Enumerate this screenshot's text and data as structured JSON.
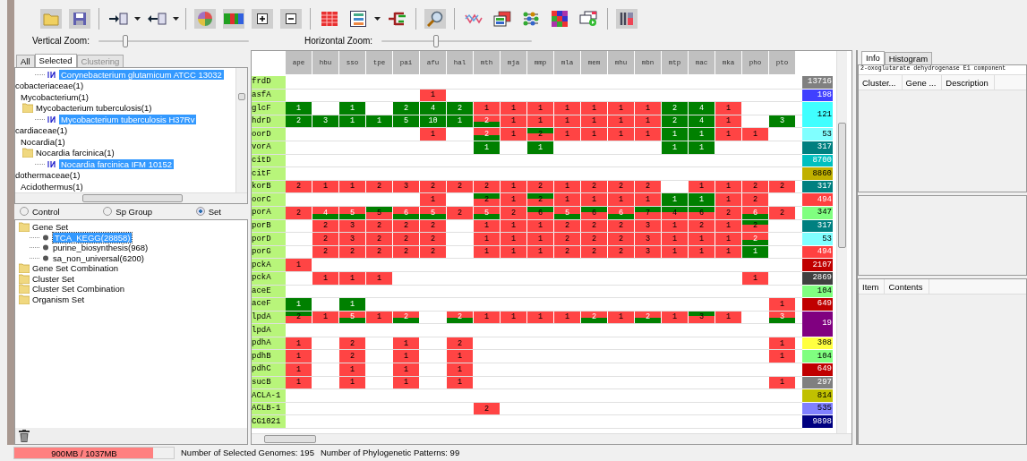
{
  "toolbar": {
    "vertical_zoom": {
      "label": "Vertical Zoom:",
      "level": 0.18
    },
    "horizontal_zoom": {
      "label": "Horizontal Zoom:",
      "level": 0.36
    }
  },
  "organism_panel": {
    "tabs": [
      {
        "label": "All",
        "selected": false,
        "disabled": false
      },
      {
        "label": "Selected",
        "selected": true,
        "disabled": false
      },
      {
        "label": "Clustering",
        "selected": false,
        "disabled": true
      }
    ],
    "tree": [
      {
        "label": "Corynebacterium glutamicum ATCC 13032",
        "kind": "strain",
        "selected": true
      },
      {
        "label": "cobacteriaceae(1)",
        "kind": "family",
        "selected": false,
        "children": [
          {
            "label": "Mycobacterium(1)",
            "kind": "genus",
            "selected": false,
            "children": [
              {
                "label": "Mycobacterium tuberculosis(1)",
                "kind": "species",
                "selected": false,
                "children": [
                  {
                    "label": "Mycobacterium tuberculosis H37Rv",
                    "kind": "strain",
                    "selected": true
                  }
                ]
              }
            ]
          }
        ]
      },
      {
        "label": "cardiaceae(1)",
        "kind": "family",
        "selected": false,
        "children": [
          {
            "label": "Nocardia(1)",
            "kind": "genus",
            "selected": false,
            "children": [
              {
                "label": "Nocardia farcinica(1)",
                "kind": "species",
                "selected": false,
                "children": [
                  {
                    "label": "Nocardia farcinica IFM 10152",
                    "kind": "strain",
                    "selected": true
                  }
                ]
              }
            ]
          }
        ]
      },
      {
        "label": "dothermaceae(1)",
        "kind": "family",
        "selected": false,
        "children": [
          {
            "label": "Acidothermus(1)",
            "kind": "genus",
            "selected": false
          }
        ]
      }
    ]
  },
  "set_panel": {
    "options": [
      {
        "label": "Control",
        "selected": false
      },
      {
        "label": "Sp Group",
        "selected": false
      },
      {
        "label": "Set",
        "selected": true
      }
    ],
    "tree": [
      {
        "label": "Gene Set",
        "kind": "folder",
        "selected": false,
        "children": [
          {
            "label": "TCA_KEGG(28858)",
            "kind": "set",
            "selected": true
          },
          {
            "label": "purine_biosynthesis(968)",
            "kind": "set",
            "selected": false
          },
          {
            "label": "sa_non_universal(6200)",
            "kind": "set",
            "selected": false
          }
        ]
      },
      {
        "label": "Gene Set Combination",
        "kind": "folder",
        "selected": false
      },
      {
        "label": "Cluster Set",
        "kind": "folder",
        "selected": false
      },
      {
        "label": "Cluster Set Combination",
        "kind": "folder",
        "selected": false
      },
      {
        "label": "Organism Set",
        "kind": "folder",
        "selected": false
      }
    ]
  },
  "grid": {
    "columns": [
      "ape",
      "hbu",
      "sso",
      "tpe",
      "pai",
      "afu",
      "hal",
      "mth",
      "mja",
      "mmp",
      "mla",
      "mem",
      "mhu",
      "mbn",
      "mtp",
      "mac",
      "mka",
      "pho",
      "pto"
    ],
    "rows": [
      {
        "gene": "frdD",
        "count": "13716",
        "color": "#808080",
        "merged_with_next": false,
        "cells": [
          null,
          null,
          null,
          null,
          null,
          null,
          null,
          null,
          null,
          null,
          null,
          null,
          null,
          null,
          null,
          null,
          null,
          null,
          null
        ]
      },
      {
        "gene": "asfA",
        "count": "198",
        "color": "#4040ff",
        "merged_with_next": false,
        "cells": [
          null,
          null,
          null,
          null,
          null,
          {
            "text": "1",
            "kind": "red"
          },
          null,
          null,
          null,
          null,
          null,
          null,
          null,
          null,
          null,
          null,
          null,
          null,
          null
        ]
      },
      {
        "gene": "glcF",
        "count": "121",
        "color": "#40ffff",
        "merged_with_next": true,
        "cells": [
          {
            "text": "1",
            "kind": "green"
          },
          null,
          {
            "text": "1",
            "kind": "green"
          },
          null,
          {
            "text": "2",
            "kind": "green"
          },
          {
            "text": "4",
            "kind": "green"
          },
          {
            "text": "2",
            "kind": "green"
          },
          {
            "text": "1",
            "kind": "red"
          },
          {
            "text": "1",
            "kind": "red"
          },
          {
            "text": "1",
            "kind": "red"
          },
          {
            "text": "1",
            "kind": "red"
          },
          {
            "text": "1",
            "kind": "red"
          },
          {
            "text": "1",
            "kind": "red"
          },
          {
            "text": "1",
            "kind": "red"
          },
          {
            "text": "2",
            "kind": "green"
          },
          {
            "text": "4",
            "kind": "green"
          },
          {
            "text": "1",
            "kind": "red"
          },
          null,
          null
        ]
      },
      {
        "gene": "hdrD",
        "cells": [
          {
            "text": "2",
            "kind": "green"
          },
          {
            "text": "3",
            "kind": "green"
          },
          {
            "text": "1",
            "kind": "green"
          },
          {
            "text": "1",
            "kind": "green"
          },
          {
            "text": "5",
            "kind": "green"
          },
          {
            "text": "10",
            "kind": "green"
          },
          {
            "text": "1",
            "kind": "green"
          },
          {
            "text": "2",
            "kind": "red-green"
          },
          {
            "text": "1",
            "kind": "red"
          },
          {
            "text": "1",
            "kind": "red"
          },
          {
            "text": "1",
            "kind": "red"
          },
          {
            "text": "1",
            "kind": "red"
          },
          {
            "text": "1",
            "kind": "red"
          },
          {
            "text": "1",
            "kind": "red"
          },
          {
            "text": "2",
            "kind": "green"
          },
          {
            "text": "4",
            "kind": "green"
          },
          {
            "text": "1",
            "kind": "red"
          },
          null,
          {
            "text": "3",
            "kind": "green"
          }
        ]
      },
      {
        "gene": "oorD",
        "count": "53",
        "color": "#80ffff",
        "merged_with_next": false,
        "cells": [
          null,
          null,
          null,
          null,
          null,
          {
            "text": "1",
            "kind": "red"
          },
          null,
          {
            "text": "2",
            "kind": "red-green"
          },
          {
            "text": "1",
            "kind": "red"
          },
          {
            "text": "2",
            "kind": "green-red"
          },
          {
            "text": "1",
            "kind": "red"
          },
          {
            "text": "1",
            "kind": "red"
          },
          {
            "text": "1",
            "kind": "red"
          },
          {
            "text": "1",
            "kind": "red"
          },
          {
            "text": "1",
            "kind": "green"
          },
          {
            "text": "1",
            "kind": "green"
          },
          {
            "text": "1",
            "kind": "red"
          },
          {
            "text": "1",
            "kind": "red"
          },
          null
        ]
      },
      {
        "gene": "vorA",
        "count": "317",
        "color": "#008080",
        "merged_with_next": false,
        "cells": [
          null,
          null,
          null,
          null,
          null,
          null,
          null,
          {
            "text": "1",
            "kind": "green"
          },
          null,
          {
            "text": "1",
            "kind": "green"
          },
          null,
          null,
          null,
          null,
          {
            "text": "1",
            "kind": "green"
          },
          {
            "text": "1",
            "kind": "green"
          },
          null,
          null,
          null
        ]
      },
      {
        "gene": "citD",
        "count": "8700",
        "color": "#00c0c0",
        "merged_with_next": false,
        "cells": [
          null,
          null,
          null,
          null,
          null,
          null,
          null,
          null,
          null,
          null,
          null,
          null,
          null,
          null,
          null,
          null,
          null,
          null,
          null
        ]
      },
      {
        "gene": "citF",
        "count": "8860",
        "color": "#c0b000",
        "merged_with_next": false,
        "cells": [
          null,
          null,
          null,
          null,
          null,
          null,
          null,
          null,
          null,
          null,
          null,
          null,
          null,
          null,
          null,
          null,
          null,
          null,
          null
        ]
      },
      {
        "gene": "korB",
        "count": "317",
        "color": "#008080",
        "merged_with_next": false,
        "cells": [
          {
            "text": "2",
            "kind": "red"
          },
          {
            "text": "1",
            "kind": "red"
          },
          {
            "text": "1",
            "kind": "red"
          },
          {
            "text": "2",
            "kind": "red"
          },
          {
            "text": "3",
            "kind": "red"
          },
          {
            "text": "2",
            "kind": "red"
          },
          {
            "text": "2",
            "kind": "red"
          },
          {
            "text": "2",
            "kind": "red"
          },
          {
            "text": "1",
            "kind": "red"
          },
          {
            "text": "2",
            "kind": "red"
          },
          {
            "text": "1",
            "kind": "red"
          },
          {
            "text": "2",
            "kind": "red"
          },
          {
            "text": "2",
            "kind": "red"
          },
          {
            "text": "2",
            "kind": "red"
          },
          null,
          {
            "text": "1",
            "kind": "red"
          },
          {
            "text": "1",
            "kind": "red"
          },
          {
            "text": "2",
            "kind": "red"
          },
          {
            "text": "2",
            "kind": "red"
          }
        ]
      },
      {
        "gene": "oorC",
        "count": "494",
        "color": "#ff4040",
        "merged_with_next": false,
        "cells": [
          null,
          null,
          null,
          null,
          null,
          {
            "text": "1",
            "kind": "red"
          },
          null,
          {
            "text": "2",
            "kind": "green-red"
          },
          {
            "text": "1",
            "kind": "red"
          },
          {
            "text": "2",
            "kind": "green-red"
          },
          {
            "text": "1",
            "kind": "red"
          },
          {
            "text": "1",
            "kind": "red"
          },
          {
            "text": "1",
            "kind": "red"
          },
          {
            "text": "1",
            "kind": "red"
          },
          {
            "text": "1",
            "kind": "green"
          },
          {
            "text": "1",
            "kind": "green"
          },
          {
            "text": "1",
            "kind": "red"
          },
          {
            "text": "2",
            "kind": "red"
          },
          null
        ]
      },
      {
        "gene": "porA",
        "count": "347",
        "color": "#80ff80",
        "merged_with_next": false,
        "cells": [
          {
            "text": "2",
            "kind": "red"
          },
          {
            "text": "4",
            "kind": "red-green"
          },
          {
            "text": "5",
            "kind": "red-green"
          },
          {
            "text": "5",
            "kind": "green-red"
          },
          {
            "text": "6",
            "kind": "red-green"
          },
          {
            "text": "5",
            "kind": "red-green"
          },
          {
            "text": "2",
            "kind": "red"
          },
          {
            "text": "5",
            "kind": "red-green"
          },
          {
            "text": "2",
            "kind": "red"
          },
          {
            "text": "6",
            "kind": "green-red"
          },
          {
            "text": "5",
            "kind": "red-green"
          },
          {
            "text": "6",
            "kind": "green-red"
          },
          {
            "text": "6",
            "kind": "red-green"
          },
          {
            "text": "7",
            "kind": "green-red"
          },
          {
            "text": "4",
            "kind": "green-red"
          },
          {
            "text": "6",
            "kind": "green-red"
          },
          {
            "text": "2",
            "kind": "red"
          },
          {
            "text": "6",
            "kind": "red-green"
          },
          {
            "text": "2",
            "kind": "red"
          }
        ]
      },
      {
        "gene": "porB",
        "count": "317",
        "color": "#008080",
        "merged_with_next": false,
        "cells": [
          null,
          {
            "text": "2",
            "kind": "red"
          },
          {
            "text": "3",
            "kind": "red"
          },
          {
            "text": "2",
            "kind": "red"
          },
          {
            "text": "2",
            "kind": "red"
          },
          {
            "text": "2",
            "kind": "red"
          },
          null,
          {
            "text": "1",
            "kind": "red"
          },
          {
            "text": "1",
            "kind": "red"
          },
          {
            "text": "1",
            "kind": "red"
          },
          {
            "text": "2",
            "kind": "red"
          },
          {
            "text": "2",
            "kind": "red"
          },
          {
            "text": "2",
            "kind": "red"
          },
          {
            "text": "3",
            "kind": "red"
          },
          {
            "text": "1",
            "kind": "red"
          },
          {
            "text": "2",
            "kind": "red"
          },
          {
            "text": "1",
            "kind": "red"
          },
          {
            "text": "2",
            "kind": "green-red"
          },
          null
        ]
      },
      {
        "gene": "porD",
        "count": "53",
        "color": "#80ffff",
        "merged_with_next": false,
        "cells": [
          null,
          {
            "text": "2",
            "kind": "red"
          },
          {
            "text": "3",
            "kind": "red"
          },
          {
            "text": "2",
            "kind": "red"
          },
          {
            "text": "2",
            "kind": "red"
          },
          {
            "text": "2",
            "kind": "red"
          },
          null,
          {
            "text": "1",
            "kind": "red"
          },
          {
            "text": "1",
            "kind": "red"
          },
          {
            "text": "1",
            "kind": "red"
          },
          {
            "text": "2",
            "kind": "red"
          },
          {
            "text": "2",
            "kind": "red"
          },
          {
            "text": "2",
            "kind": "red"
          },
          {
            "text": "3",
            "kind": "red"
          },
          {
            "text": "1",
            "kind": "red"
          },
          {
            "text": "1",
            "kind": "red"
          },
          {
            "text": "1",
            "kind": "red"
          },
          {
            "text": "2",
            "kind": "red-green"
          },
          null
        ]
      },
      {
        "gene": "porG",
        "count": "494",
        "color": "#ff4040",
        "merged_with_next": false,
        "cells": [
          null,
          {
            "text": "2",
            "kind": "red"
          },
          {
            "text": "2",
            "kind": "red"
          },
          {
            "text": "2",
            "kind": "red"
          },
          {
            "text": "2",
            "kind": "red"
          },
          {
            "text": "2",
            "kind": "red"
          },
          null,
          {
            "text": "1",
            "kind": "red"
          },
          {
            "text": "1",
            "kind": "red"
          },
          {
            "text": "1",
            "kind": "red"
          },
          {
            "text": "2",
            "kind": "red"
          },
          {
            "text": "2",
            "kind": "red"
          },
          {
            "text": "2",
            "kind": "red"
          },
          {
            "text": "3",
            "kind": "red"
          },
          {
            "text": "1",
            "kind": "red"
          },
          {
            "text": "1",
            "kind": "red"
          },
          {
            "text": "1",
            "kind": "red"
          },
          {
            "text": "1",
            "kind": "green"
          },
          null
        ]
      },
      {
        "gene": "pckA",
        "count": "2107",
        "color": "#c00000",
        "merged_with_next": false,
        "cells": [
          {
            "text": "1",
            "kind": "red"
          },
          null,
          null,
          null,
          null,
          null,
          null,
          null,
          null,
          null,
          null,
          null,
          null,
          null,
          null,
          null,
          null,
          null,
          null
        ]
      },
      {
        "gene": "pckA",
        "count": "2869",
        "color": "#404040",
        "merged_with_next": false,
        "cells": [
          null,
          {
            "text": "1",
            "kind": "red"
          },
          {
            "text": "1",
            "kind": "red"
          },
          {
            "text": "1",
            "kind": "red"
          },
          null,
          null,
          null,
          null,
          null,
          null,
          null,
          null,
          null,
          null,
          null,
          null,
          null,
          {
            "text": "1",
            "kind": "red"
          },
          null
        ]
      },
      {
        "gene": "aceE",
        "count": "104",
        "color": "#80ff80",
        "merged_with_next": false,
        "cells": [
          null,
          null,
          null,
          null,
          null,
          null,
          null,
          null,
          null,
          null,
          null,
          null,
          null,
          null,
          null,
          null,
          null,
          null,
          null
        ]
      },
      {
        "gene": "aceF",
        "count": "649",
        "color": "#c00000",
        "merged_with_next": false,
        "cells": [
          {
            "text": "1",
            "kind": "green"
          },
          null,
          {
            "text": "1",
            "kind": "green"
          },
          null,
          null,
          null,
          null,
          null,
          null,
          null,
          null,
          null,
          null,
          null,
          null,
          null,
          null,
          null,
          {
            "text": "1",
            "kind": "red"
          }
        ]
      },
      {
        "gene": "lpdA",
        "count": "19",
        "color": "#800080",
        "merged_with_next": true,
        "cells": [
          {
            "text": "2",
            "kind": "green-red"
          },
          {
            "text": "1",
            "kind": "red"
          },
          {
            "text": "5",
            "kind": "red-green"
          },
          {
            "text": "1",
            "kind": "red"
          },
          {
            "text": "2",
            "kind": "red-green"
          },
          null,
          {
            "text": "2",
            "kind": "red-green"
          },
          {
            "text": "1",
            "kind": "red"
          },
          {
            "text": "1",
            "kind": "red"
          },
          {
            "text": "1",
            "kind": "red"
          },
          {
            "text": "1",
            "kind": "red"
          },
          {
            "text": "2",
            "kind": "red-green"
          },
          {
            "text": "1",
            "kind": "red"
          },
          {
            "text": "2",
            "kind": "red-green"
          },
          {
            "text": "1",
            "kind": "red"
          },
          {
            "text": "3",
            "kind": "green-red"
          },
          {
            "text": "1",
            "kind": "red"
          },
          null,
          {
            "text": "3",
            "kind": "red-green"
          }
        ]
      },
      {
        "gene": "lpdA",
        "cells": [
          null,
          null,
          null,
          null,
          null,
          null,
          null,
          null,
          null,
          null,
          null,
          null,
          null,
          null,
          null,
          null,
          null,
          null,
          null
        ]
      },
      {
        "gene": "pdhA",
        "count": "308",
        "color": "#ffff40",
        "merged_with_next": false,
        "cells": [
          {
            "text": "1",
            "kind": "red"
          },
          null,
          {
            "text": "2",
            "kind": "red"
          },
          null,
          {
            "text": "1",
            "kind": "red"
          },
          null,
          {
            "text": "2",
            "kind": "red"
          },
          null,
          null,
          null,
          null,
          null,
          null,
          null,
          null,
          null,
          null,
          null,
          {
            "text": "1",
            "kind": "red"
          }
        ]
      },
      {
        "gene": "pdhB",
        "count": "104",
        "color": "#80ff80",
        "merged_with_next": false,
        "cells": [
          {
            "text": "1",
            "kind": "red"
          },
          null,
          {
            "text": "2",
            "kind": "red"
          },
          null,
          {
            "text": "1",
            "kind": "red"
          },
          null,
          {
            "text": "1",
            "kind": "red"
          },
          null,
          null,
          null,
          null,
          null,
          null,
          null,
          null,
          null,
          null,
          null,
          {
            "text": "1",
            "kind": "red"
          }
        ]
      },
      {
        "gene": "pdhC",
        "count": "649",
        "color": "#c00000",
        "merged_with_next": false,
        "cells": [
          {
            "text": "1",
            "kind": "red"
          },
          null,
          {
            "text": "1",
            "kind": "red"
          },
          null,
          {
            "text": "1",
            "kind": "red"
          },
          null,
          {
            "text": "1",
            "kind": "red"
          },
          null,
          null,
          null,
          null,
          null,
          null,
          null,
          null,
          null,
          null,
          null,
          null
        ]
      },
      {
        "gene": "sucB",
        "count": "297",
        "color": "#808080",
        "merged_with_next": false,
        "cells": [
          {
            "text": "1",
            "kind": "red"
          },
          null,
          {
            "text": "1",
            "kind": "red"
          },
          null,
          {
            "text": "1",
            "kind": "red"
          },
          null,
          {
            "text": "1",
            "kind": "red"
          },
          null,
          null,
          null,
          null,
          null,
          null,
          null,
          null,
          null,
          null,
          null,
          {
            "text": "1",
            "kind": "red"
          }
        ]
      },
      {
        "gene": "ACLA-1",
        "count": "814",
        "color": "#c0c000",
        "merged_with_next": false,
        "cells": [
          null,
          null,
          null,
          null,
          null,
          null,
          null,
          null,
          null,
          null,
          null,
          null,
          null,
          null,
          null,
          null,
          null,
          null,
          null
        ]
      },
      {
        "gene": "ACLB-1",
        "count": "535",
        "color": "#8080ff",
        "merged_with_next": false,
        "cells": [
          null,
          null,
          null,
          null,
          null,
          null,
          null,
          {
            "text": "2",
            "kind": "red"
          },
          null,
          null,
          null,
          null,
          null,
          null,
          null,
          null,
          null,
          null,
          null
        ]
      },
      {
        "gene": "CG1021",
        "count": "9898",
        "color": "#000080",
        "merged_with_next": false,
        "cells": [
          null,
          null,
          null,
          null,
          null,
          null,
          null,
          null,
          null,
          null,
          null,
          null,
          null,
          null,
          null,
          null,
          null,
          null,
          null
        ]
      }
    ]
  },
  "info_panel": {
    "tabs": [
      {
        "label": "Info",
        "selected": true
      },
      {
        "label": "Histogram",
        "selected": false
      }
    ],
    "description": "2-oxoglutarate dehydrogenase E1 component",
    "columns": [
      "Cluster...",
      "Gene ...",
      "Description"
    ],
    "item_columns": [
      "Item",
      "Contents"
    ]
  },
  "status_bar": {
    "memory": {
      "text": "900MB / 1037MB",
      "level": 0.87
    },
    "messages": [
      "Number of Selected Genomes: 195",
      "Number of Phylogenetic Patterns: 99"
    ]
  }
}
